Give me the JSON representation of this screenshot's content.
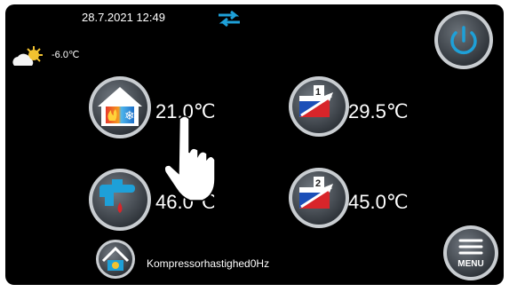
{
  "header": {
    "datetime": "28.7.2021 12:49",
    "outdoor_temp": "-6.0℃",
    "weather_icon": "sun-cloud-icon",
    "sync_icon": "swap-arrows-icon"
  },
  "tiles": {
    "room": {
      "temp": "21.0℃",
      "icon": "house-heat-cool-icon"
    },
    "circuit1": {
      "temp": "29.5℃",
      "icon": "heating-curve-1-icon",
      "number": "1"
    },
    "hot_water": {
      "temp": "46.0℃",
      "icon": "tap-water-icon"
    },
    "circuit2": {
      "temp": "45.0℃",
      "icon": "heating-curve-2-icon",
      "number": "2"
    }
  },
  "status": {
    "compressor": "Kompressorhastighed0Hz",
    "icon": "house-status-icon"
  },
  "buttons": {
    "power_icon": "power-icon",
    "menu_label": "MENU"
  },
  "colors": {
    "background": "#000000",
    "accent_blue": "#1ea0d8",
    "red": "#d8252a",
    "button_grey": "#3a3f45"
  }
}
